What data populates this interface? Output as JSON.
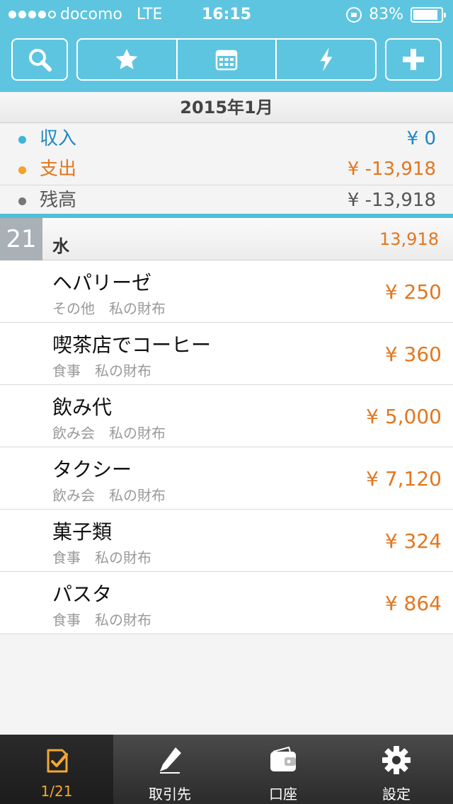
{
  "status": {
    "carrier": "docomo",
    "network": "LTE",
    "time": "16:15",
    "battery": "83%"
  },
  "month": {
    "title": "2015年1月"
  },
  "summary": {
    "income": {
      "label": "収入",
      "value": "¥ 0",
      "color": "#1e87c1"
    },
    "expense": {
      "label": "支出",
      "value": "¥ -13,918",
      "color": "#e2771f"
    },
    "balance": {
      "label": "残高",
      "value": "¥ -13,918",
      "color": "#555555"
    }
  },
  "day": {
    "number": "21",
    "weekday": "水",
    "total": "13,918"
  },
  "items": [
    {
      "name": "ヘパリーゼ",
      "category": "その他",
      "account": "私の財布",
      "amount": "¥ 250"
    },
    {
      "name": "喫茶店でコーヒー",
      "category": "食事",
      "account": "私の財布",
      "amount": "¥ 360"
    },
    {
      "name": "飲み代",
      "category": "飲み会",
      "account": "私の財布",
      "amount": "¥ 5,000"
    },
    {
      "name": "タクシー",
      "category": "飲み会",
      "account": "私の財布",
      "amount": "¥ 7,120"
    },
    {
      "name": "菓子類",
      "category": "食事",
      "account": "私の財布",
      "amount": "¥ 324"
    },
    {
      "name": "パスタ",
      "category": "食事",
      "account": "私の財布",
      "amount": "¥ 864"
    }
  ],
  "tabs": [
    {
      "label": "1/21",
      "icon": "journal-check-icon"
    },
    {
      "label": "取引先",
      "icon": "pen-icon"
    },
    {
      "label": "口座",
      "icon": "wallet-icon"
    },
    {
      "label": "設定",
      "icon": "gear-icon"
    }
  ],
  "colors": {
    "header": "#5ec5e0",
    "accent": "#e2771f",
    "income": "#1e87c1"
  }
}
